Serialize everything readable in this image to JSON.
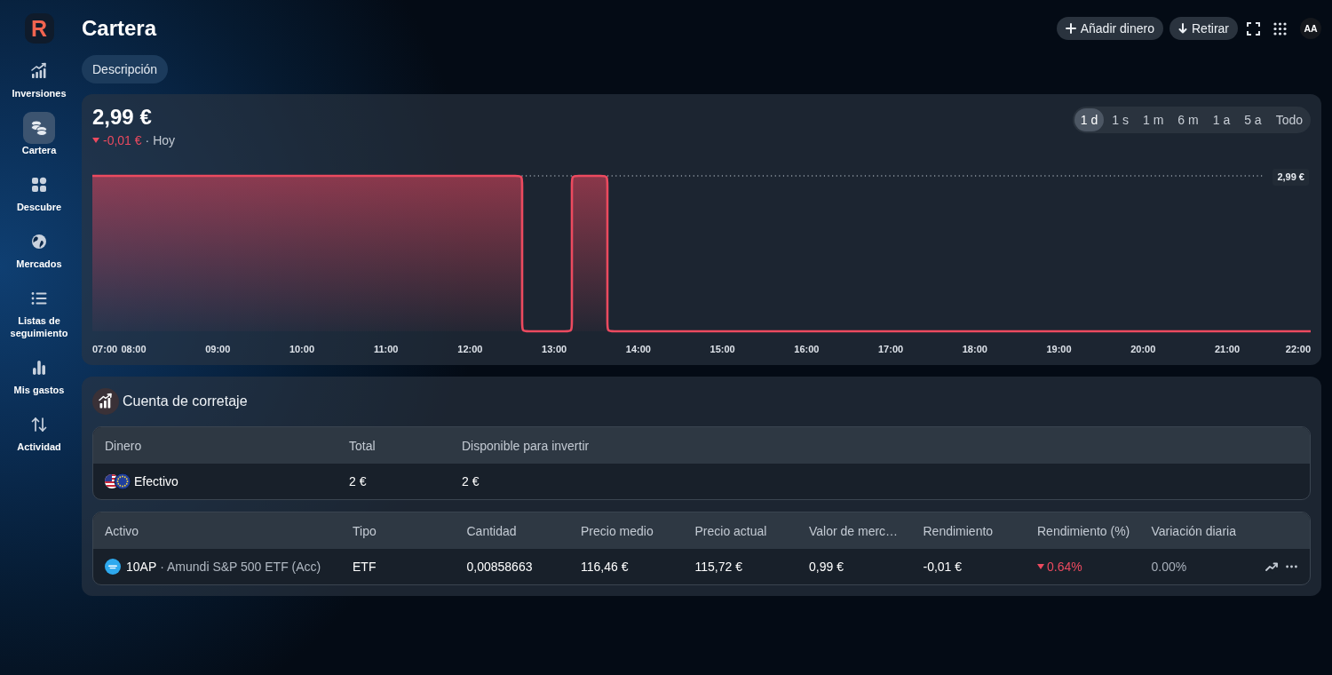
{
  "sidebar": {
    "logo": "R",
    "items": [
      {
        "label": "Inversiones",
        "selected": false
      },
      {
        "label": "Cartera",
        "selected": true
      },
      {
        "label": "Descubre",
        "selected": false
      },
      {
        "label": "Mercados",
        "selected": false
      },
      {
        "label": "Listas de seguimiento",
        "selected": false
      },
      {
        "label": "Mis gastos",
        "selected": false
      },
      {
        "label": "Actividad",
        "selected": false
      }
    ]
  },
  "header": {
    "title": "Cartera",
    "buttons": [
      {
        "label": "Añadir dinero"
      },
      {
        "label": "Retirar"
      }
    ],
    "avatar": "AA"
  },
  "tabs": [
    {
      "label": "Descripción",
      "selected": true
    }
  ],
  "portfolio": {
    "value": "2,99 €",
    "change": {
      "amount": "-0,01 €",
      "down": true,
      "period": "· Hoy"
    },
    "ranges": [
      {
        "label": "1 d",
        "selected": true
      },
      {
        "label": "1 s",
        "selected": false
      },
      {
        "label": "1 m",
        "selected": false
      },
      {
        "label": "6 m",
        "selected": false
      },
      {
        "label": "1 a",
        "selected": false
      },
      {
        "label": "5 a",
        "selected": false
      },
      {
        "label": "Todo",
        "selected": false
      }
    ],
    "chart": {
      "reference_label": "2,99 €",
      "x_labels": [
        "07:00",
        "08:00",
        "09:00",
        "10:00",
        "11:00",
        "12:00",
        "13:00",
        "14:00",
        "15:00",
        "16:00",
        "17:00",
        "18:00",
        "19:00",
        "20:00",
        "21:00",
        "22:00"
      ]
    }
  },
  "account": {
    "title": "Cuenta de corretaje",
    "cash_table": {
      "columns": [
        "Dinero",
        "Total",
        "Disponible para invertir"
      ],
      "rows": [
        {
          "name": "Efectivo",
          "total": "2 €",
          "available": "2 €"
        }
      ]
    },
    "holdings_table": {
      "columns": [
        "Activo",
        "Tipo",
        "Cantidad",
        "Precio medio",
        "Precio actual",
        "Valor de merc…",
        "Rendimiento",
        "Rendimiento (%)",
        "Variación diaria"
      ],
      "rows": [
        {
          "symbol": "10AP",
          "name": "· Amundi S&P 500 ETF (Acc)",
          "type": "ETF",
          "quantity": "0,00858663",
          "avg_price": "116,46 €",
          "current_price": "115,72 €",
          "market_value": "0,99 €",
          "return": "-0,01 €",
          "return_pct": {
            "text": "0.64%",
            "down": true
          },
          "daily_change": {
            "text": "0.00%",
            "down": false
          }
        }
      ]
    }
  }
}
